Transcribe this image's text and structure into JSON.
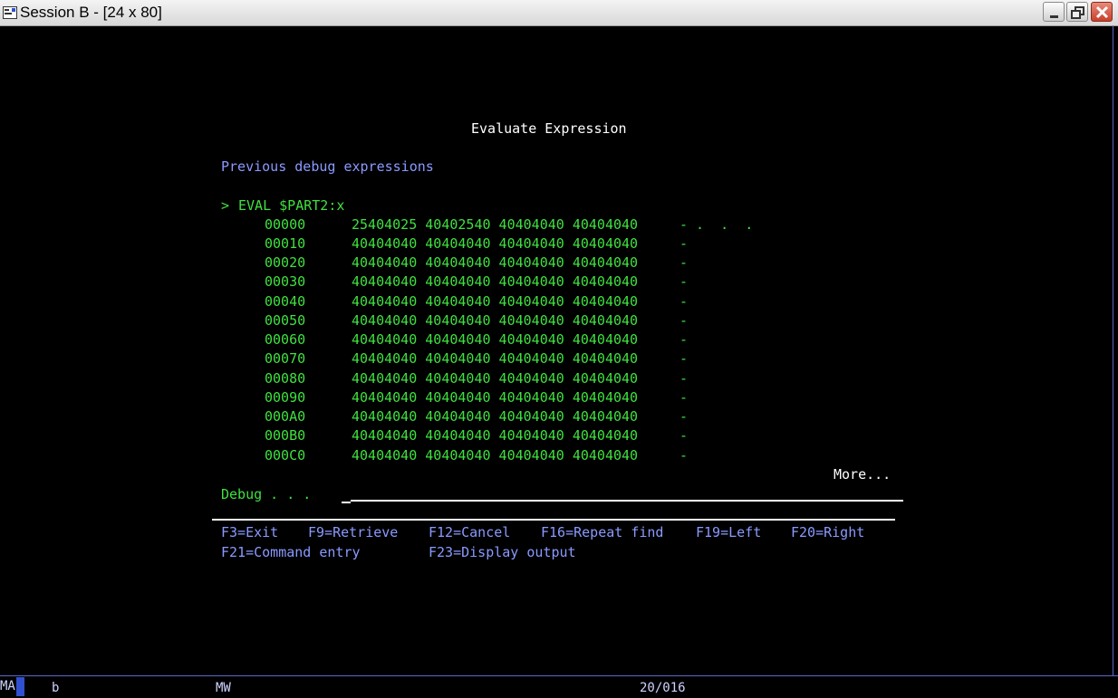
{
  "window": {
    "title": "Session B - [24 x 80]"
  },
  "screen": {
    "heading": "Evaluate Expression",
    "subheading": "Previous debug expressions",
    "command_prefix": ">",
    "command": "EVAL $PART2:x",
    "rows": [
      {
        "addr": "00000",
        "hex": "25404025 40402540 40404040 40404040",
        "chars": "- .  .  ."
      },
      {
        "addr": "00010",
        "hex": "40404040 40404040 40404040 40404040",
        "chars": "-"
      },
      {
        "addr": "00020",
        "hex": "40404040 40404040 40404040 40404040",
        "chars": "-"
      },
      {
        "addr": "00030",
        "hex": "40404040 40404040 40404040 40404040",
        "chars": "-"
      },
      {
        "addr": "00040",
        "hex": "40404040 40404040 40404040 40404040",
        "chars": "-"
      },
      {
        "addr": "00050",
        "hex": "40404040 40404040 40404040 40404040",
        "chars": "-"
      },
      {
        "addr": "00060",
        "hex": "40404040 40404040 40404040 40404040",
        "chars": "-"
      },
      {
        "addr": "00070",
        "hex": "40404040 40404040 40404040 40404040",
        "chars": "-"
      },
      {
        "addr": "00080",
        "hex": "40404040 40404040 40404040 40404040",
        "chars": "-"
      },
      {
        "addr": "00090",
        "hex": "40404040 40404040 40404040 40404040",
        "chars": "-"
      },
      {
        "addr": "000A0",
        "hex": "40404040 40404040 40404040 40404040",
        "chars": "-"
      },
      {
        "addr": "000B0",
        "hex": "40404040 40404040 40404040 40404040",
        "chars": "-"
      },
      {
        "addr": "000C0",
        "hex": "40404040 40404040 40404040 40404040",
        "chars": "-"
      }
    ],
    "more": "More...",
    "debug_label": "Debug . . .",
    "debug_value": "",
    "fkeys_line1": [
      "F3=Exit",
      "F9=Retrieve",
      "F12=Cancel",
      "F16=Repeat find",
      "F19=Left",
      "F20=Right"
    ],
    "fkeys_line2": [
      "F21=Command entry",
      "F23=Display output"
    ]
  },
  "status": {
    "left": "MA",
    "session": "b",
    "mode": "MW",
    "cursor_pos": "20/016"
  },
  "colors": {
    "green": "#40e040",
    "white": "#ffffff",
    "blue": "#8a9aff",
    "background": "#000000"
  }
}
